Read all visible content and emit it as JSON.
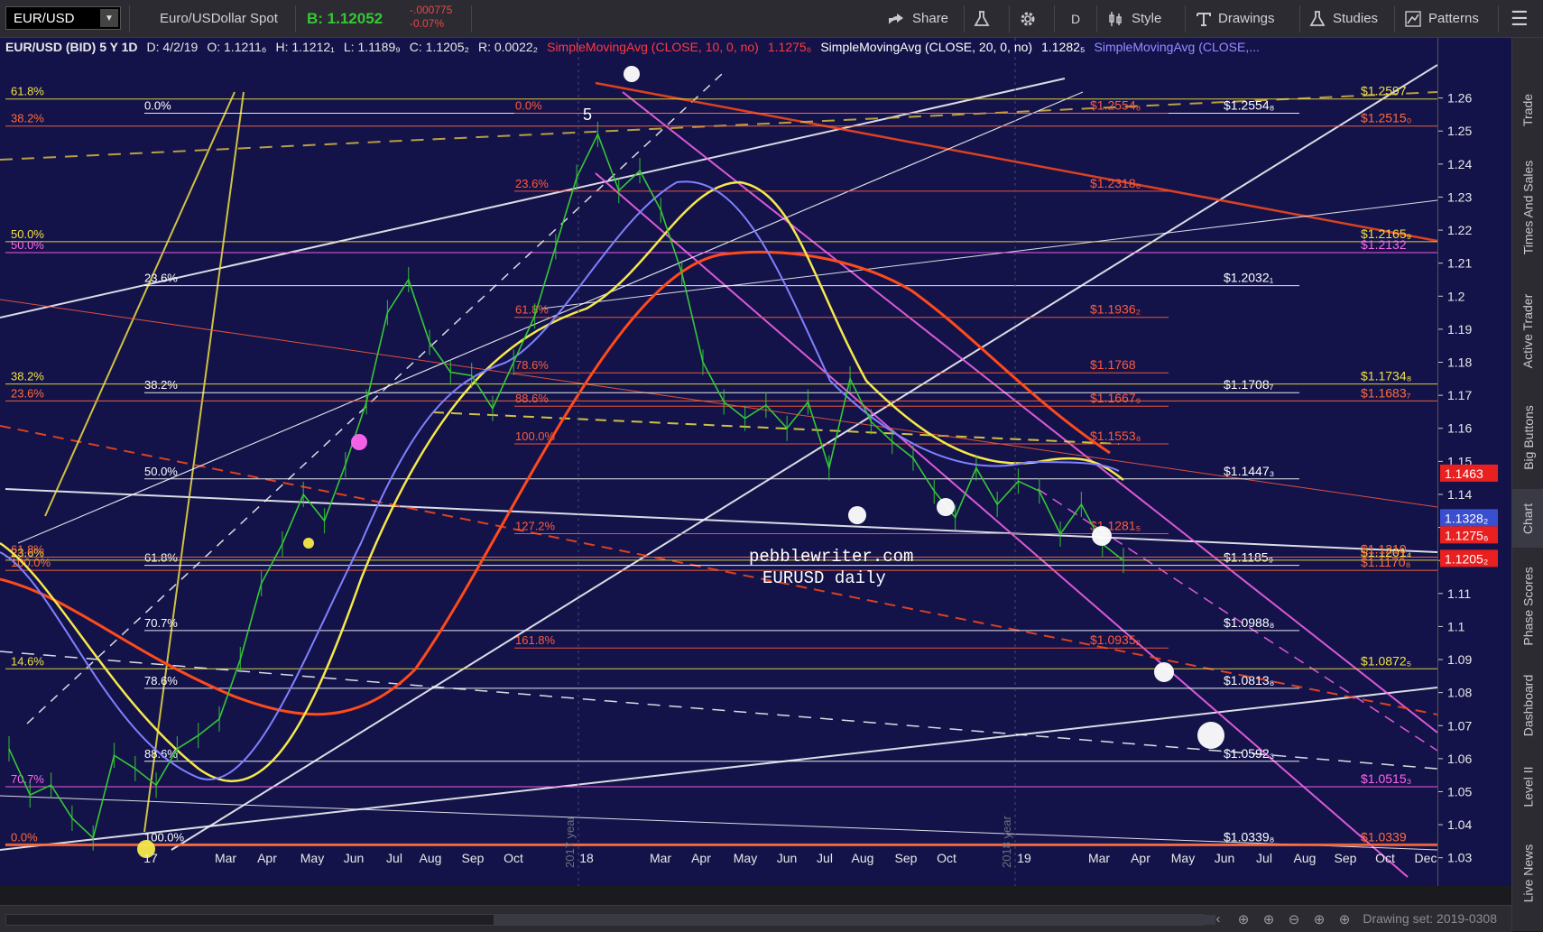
{
  "toolbar": {
    "symbol": "EUR/USD",
    "description": "Euro/USDollar Spot",
    "bid_label": "B: 1.12052",
    "change_abs": "-.000775",
    "change_pct": "-0.07%",
    "share": "Share",
    "timeframe": "D",
    "style": "Style",
    "drawings": "Drawings",
    "studies": "Studies",
    "patterns": "Patterns"
  },
  "info_bar": {
    "title": "EUR/USD (BID) 5 Y 1D",
    "date": "D: 4/2/19",
    "open": "O: 1.1211₆",
    "high": "H: 1.1212₁",
    "low": "L: 1.1189₉",
    "close": "C: 1.1205₂",
    "range": "R: 0.0022₂",
    "sma10_label": "SimpleMovingAvg (CLOSE, 10, 0, no)",
    "sma10_value": "1.1275₆",
    "sma20_label": "SimpleMovingAvg (CLOSE, 20, 0, no)",
    "sma20_value": "1.1282₅",
    "sma50_label": "SimpleMovingAvg (CLOSE,..."
  },
  "side_tabs": [
    "Trade",
    "Times And Sales",
    "Active Trader",
    "Big Buttons",
    "Chart",
    "Phase Scores",
    "Dashboard",
    "Level II",
    "Live News"
  ],
  "drawing_set": "Drawing set: 2019-0308",
  "colors": {
    "background": "#13134a",
    "price": "#36c736",
    "fib_white": "#ffffff",
    "fib_yellow": "#f0e040",
    "fib_red": "#ff5a3c",
    "fib_magenta": "#ff66ee",
    "sma_white": "#ffffff",
    "sma_yellow": "#f5e94a",
    "sma_blue": "#8080ff",
    "sma_red": "#ff4a1a"
  },
  "watermark": [
    "pebblewriter.com",
    "EURUSD daily"
  ],
  "year_markers": [
    "2017 year",
    "2018 year"
  ],
  "chart_data": {
    "type": "line",
    "title": "",
    "xlabel": "",
    "ylabel": "",
    "x_ticks": [
      "17",
      "Mar",
      "Apr",
      "May",
      "Jun",
      "Jul",
      "Aug",
      "Sep",
      "Oct",
      "18",
      "Mar",
      "Apr",
      "May",
      "Jun",
      "Jul",
      "Aug",
      "Sep",
      "Oct",
      "19",
      "Mar",
      "Apr",
      "May",
      "Jun",
      "Jul",
      "Aug",
      "Sep",
      "Oct",
      "Dec"
    ],
    "ylim": [
      1.022,
      1.27
    ],
    "y_ticks": [
      1.03,
      1.04,
      1.05,
      1.06,
      1.07,
      1.08,
      1.09,
      1.1,
      1.11,
      1.12,
      1.13,
      1.14,
      1.15,
      1.16,
      1.17,
      1.18,
      1.19,
      1.2,
      1.21,
      1.22,
      1.23,
      1.24,
      1.25,
      1.26
    ],
    "y_tick_labels": [
      "1.03",
      "1.04",
      "1.05",
      "1.06",
      "1.07",
      "1.08",
      "1.09",
      "1.1",
      "1.11",
      "1.12",
      "1.13",
      "1.14",
      "1.15",
      "1.16",
      "1.17",
      "1.18",
      "1.19",
      "1.2",
      "1.21",
      "1.22",
      "1.23",
      "1.24",
      "1.25",
      "1.26"
    ],
    "grid": false,
    "price_labels": [
      {
        "text": "1.1463",
        "value": 1.1463,
        "color": "#e82020"
      },
      {
        "text": "1.1328₂",
        "value": 1.1328,
        "color": "#3a4fd0"
      },
      {
        "text": "1.1275₆",
        "value": 1.1276,
        "color": "#e82020"
      },
      {
        "text": "1.1205₂",
        "value": 1.1205,
        "color": "#e82020"
      }
    ],
    "series": [
      {
        "name": "EUR/USD",
        "values": [
          1.063,
          1.049,
          1.052,
          1.042,
          1.036,
          1.061,
          1.057,
          1.052,
          1.063,
          1.067,
          1.072,
          1.09,
          1.113,
          1.125,
          1.14,
          1.132,
          1.149,
          1.168,
          1.195,
          1.205,
          1.186,
          1.177,
          1.176,
          1.166,
          1.18,
          1.194,
          1.215,
          1.236,
          1.249,
          1.232,
          1.238,
          1.226,
          1.207,
          1.18,
          1.168,
          1.163,
          1.167,
          1.16,
          1.168,
          1.148,
          1.175,
          1.162,
          1.156,
          1.151,
          1.141,
          1.133,
          1.148,
          1.137,
          1.144,
          1.141,
          1.128,
          1.137,
          1.125,
          1.12
        ]
      }
    ],
    "fib_levels": [
      {
        "label": "0.0%",
        "value": 1.2554,
        "price_text": "$1.2554₈",
        "color": "white"
      },
      {
        "label": "23.6%",
        "value": 1.2032,
        "price_text": "$1.2032₁",
        "color": "white"
      },
      {
        "label": "38.2%",
        "value": 1.1708,
        "price_text": "$1.1708₇",
        "color": "white"
      },
      {
        "label": "50.0%",
        "value": 1.1447,
        "price_text": "$1.1447₃",
        "color": "white"
      },
      {
        "label": "61.8%",
        "value": 1.1185,
        "price_text": "$1.1185₉",
        "color": "white"
      },
      {
        "label": "70.7%",
        "value": 1.0988,
        "price_text": "$1.0988₈",
        "color": "white"
      },
      {
        "label": "78.6%",
        "value": 1.0813,
        "price_text": "$1.0813₈",
        "color": "white"
      },
      {
        "label": "88.6%",
        "value": 1.0592,
        "price_text": "$1.0592₃",
        "color": "white"
      },
      {
        "label": "100.0%",
        "value": 1.0339,
        "price_text": "$1.0339₈",
        "color": "white"
      },
      {
        "label": "0.0%",
        "value": 1.2554,
        "price_text": "$1.2554₈",
        "color": "red"
      },
      {
        "label": "23.6%",
        "value": 1.2318,
        "price_text": "$1.2318₆",
        "color": "red"
      },
      {
        "label": "61.8%",
        "value": 1.1936,
        "price_text": "$1.1936₂",
        "color": "red"
      },
      {
        "label": "78.6%",
        "value": 1.1768,
        "price_text": "$1.1768",
        "color": "red"
      },
      {
        "label": "88.6%",
        "value": 1.1667,
        "price_text": "$1.1667₉",
        "color": "red"
      },
      {
        "label": "100.0%",
        "value": 1.1553,
        "price_text": "$1.1553₈",
        "color": "red"
      },
      {
        "label": "127.2%",
        "value": 1.1281,
        "price_text": "$1.1281₅",
        "color": "red"
      },
      {
        "label": "161.8%",
        "value": 1.0935,
        "price_text": "$1.0935₂",
        "color": "red"
      },
      {
        "label": "61.8%",
        "value": 1.2597,
        "price_text": "$1.2597",
        "color": "yellow"
      },
      {
        "label": "50.0%",
        "value": 1.2165,
        "price_text": "$1.2165₉",
        "color": "yellow"
      },
      {
        "label": "38.2%",
        "value": 1.1734,
        "price_text": "$1.1734₈",
        "color": "yellow"
      },
      {
        "label": "23.6%",
        "value": 1.1201,
        "price_text": "$1.1201₄",
        "color": "yellow"
      },
      {
        "label": "14.6%",
        "value": 1.0872,
        "price_text": "$1.0872₅",
        "color": "yellow"
      },
      {
        "label": "0.0%",
        "value": 1.0339,
        "price_text": "$1.0339",
        "color": "orange"
      },
      {
        "label": "38.2%",
        "value": 1.2515,
        "price_text": "$1.2515₀",
        "color": "orange"
      },
      {
        "label": "23.6%",
        "value": 1.1683,
        "price_text": "$1.1683₇",
        "color": "orange"
      },
      {
        "label": "61.8%",
        "value": 1.121,
        "price_text": "$1.1210",
        "color": "orange"
      },
      {
        "label": "100.0%",
        "value": 1.117,
        "price_text": "$1.1170₈",
        "color": "orange"
      },
      {
        "label": "50.0%",
        "value": 1.2132,
        "price_text": "$1.2132",
        "color": "magenta"
      },
      {
        "label": "70.7%",
        "value": 1.0515,
        "price_text": "$1.0515₃",
        "color": "magenta"
      }
    ],
    "annotations": [
      "5"
    ]
  }
}
